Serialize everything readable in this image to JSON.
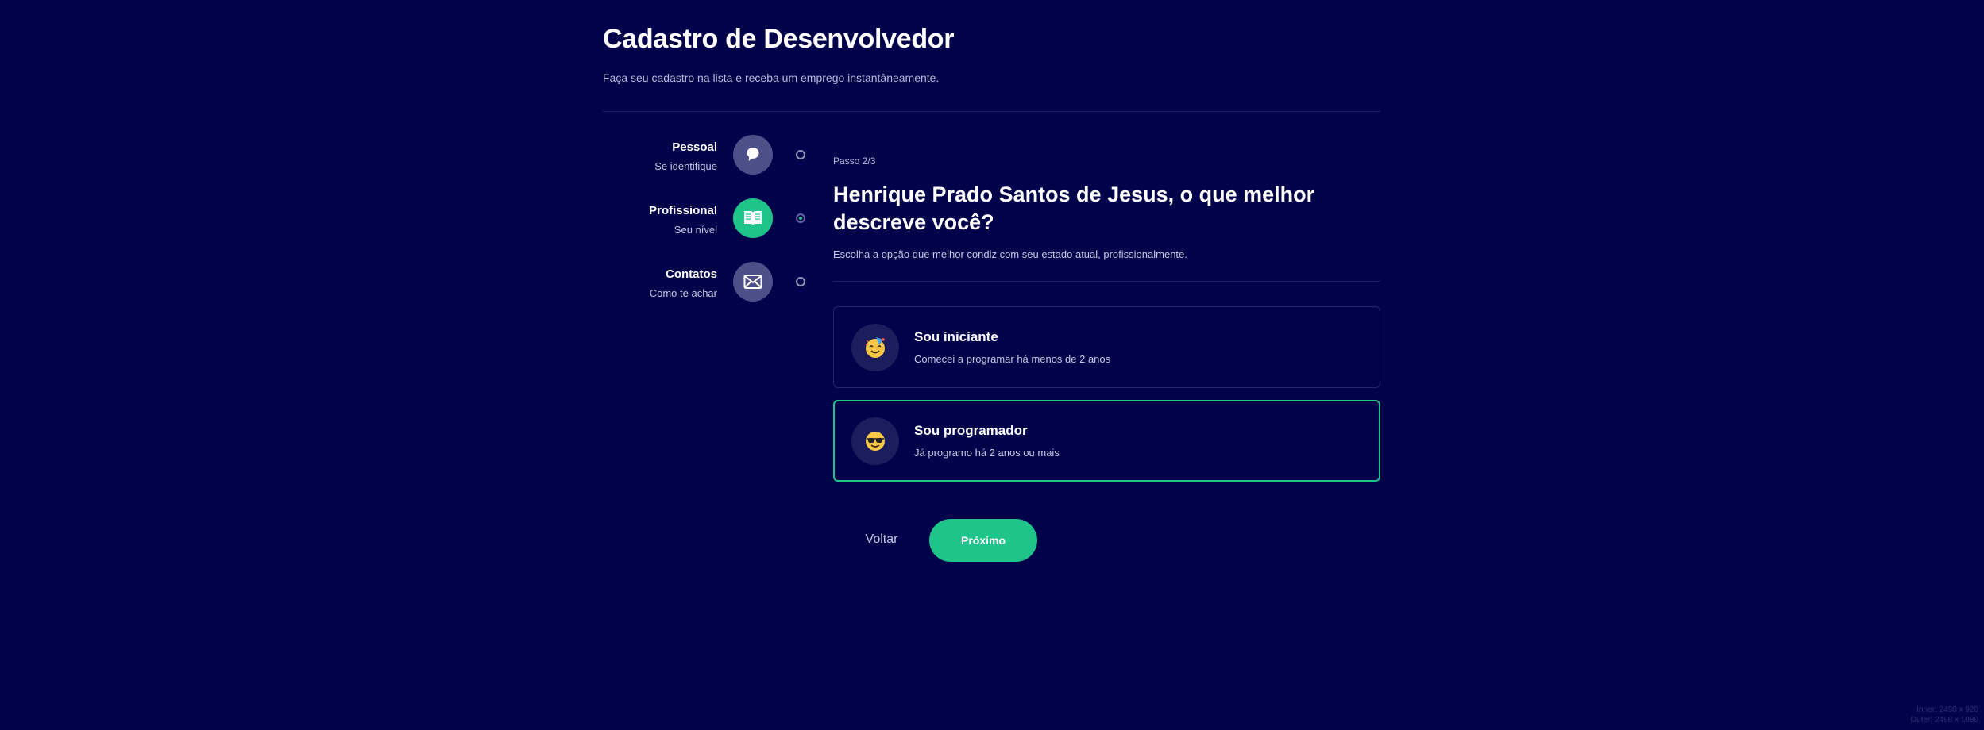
{
  "header": {
    "title": "Cadastro de Desenvolvedor",
    "subtitle": "Faça seu cadastro na lista e receba um emprego instantâneamente."
  },
  "steps": [
    {
      "title": "Pessoal",
      "description": "Se identifique",
      "icon": "speech-bubble-icon",
      "active": false
    },
    {
      "title": "Profissional",
      "description": "Seu nível",
      "icon": "book-icon",
      "active": true
    },
    {
      "title": "Contatos",
      "description": "Como te achar",
      "icon": "mail-icon",
      "active": false
    }
  ],
  "form": {
    "step_label": "Passo 2/3",
    "question": "Henrique Prado Santos de Jesus, o que melhor descreve você?",
    "hint": "Escolha a opção que melhor condiz com seu estado atual, profissionalmente.",
    "options": [
      {
        "emoji": "🥳",
        "title": "Sou iniciante",
        "description": "Comecei a programar há menos de 2 anos",
        "selected": false
      },
      {
        "emoji": "😎",
        "title": "Sou programador",
        "description": "Já programo há 2 anos ou mais",
        "selected": true
      }
    ],
    "back_label": "Voltar",
    "next_label": "Próximo"
  },
  "viewport_info": {
    "inner": "Inner: 2498 x 920",
    "outer": "Outer: 2498 x 1080"
  },
  "colors": {
    "background": "#02024a",
    "accent": "#1fc48b",
    "step_inactive": "#4c4f88"
  }
}
